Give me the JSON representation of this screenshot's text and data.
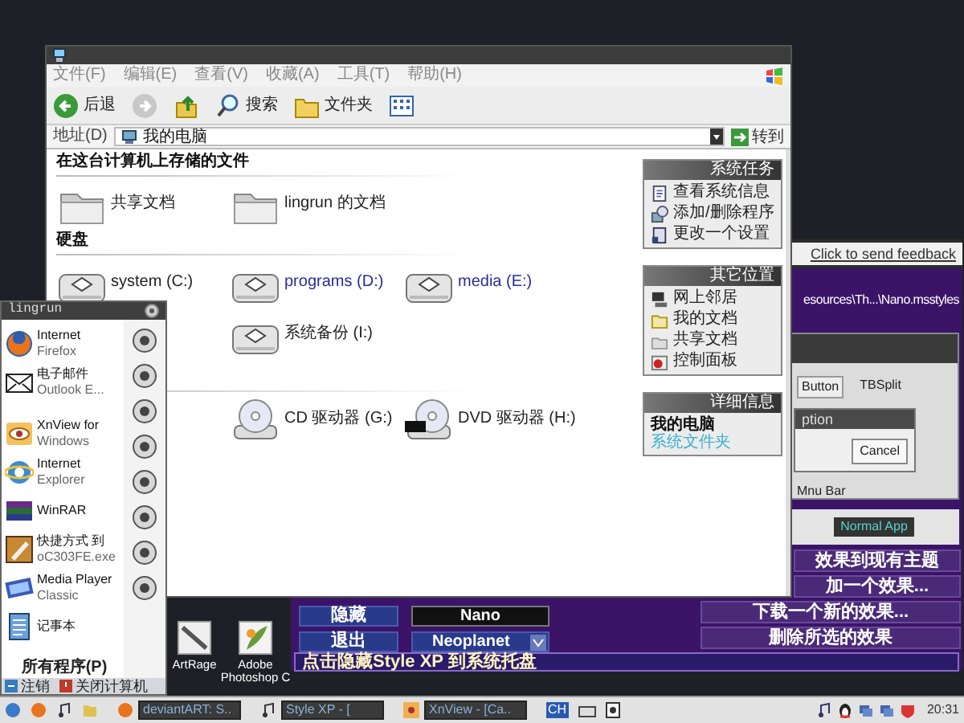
{
  "explorer": {
    "menu": [
      "文件(F)",
      "编辑(E)",
      "查看(V)",
      "收藏(A)",
      "工具(T)",
      "帮助(H)"
    ],
    "toolbar": [
      {
        "kind": "back",
        "label": "后退"
      },
      {
        "kind": "forward"
      },
      {
        "kind": "up"
      },
      {
        "kind": "search",
        "label": "搜索"
      },
      {
        "kind": "folders",
        "label": "文件夹"
      },
      {
        "kind": "views"
      }
    ],
    "address": {
      "label": "地址(D)",
      "value": "我的电脑",
      "go": "转到"
    },
    "sections": [
      {
        "title": "在这台计算机上存储的文件",
        "items": [
          {
            "kind": "folder",
            "label": "共享文档"
          },
          {
            "kind": "folder",
            "label": "lingrun 的文档"
          }
        ]
      },
      {
        "title": "硬盘",
        "items": [
          {
            "kind": "hdd",
            "label": "system (C:)",
            "color": "#222222"
          },
          {
            "kind": "hdd",
            "label": "programs (D:)",
            "color": "#2a2a9a"
          },
          {
            "kind": "hdd",
            "label": "media (E:)",
            "color": "#2a2a9a"
          },
          {
            "kind": "covered"
          },
          {
            "kind": "hdd",
            "label": "系统备份 (I:)",
            "color": "#222222"
          }
        ]
      },
      {
        "items": [
          {
            "kind": "covered"
          },
          {
            "kind": "cd",
            "label": "CD 驱动器 (G:)"
          },
          {
            "kind": "dvd",
            "label": "DVD 驱动器 (H:)"
          }
        ]
      }
    ],
    "panels": [
      {
        "title": "系统任务",
        "items": [
          {
            "kind": "info",
            "label": "查看系统信息"
          },
          {
            "kind": "addremove",
            "label": "添加/删除程序"
          },
          {
            "kind": "settings",
            "label": "更改一个设置"
          }
        ]
      },
      {
        "title": "其它位置",
        "items": [
          {
            "kind": "network",
            "label": "网上邻居"
          },
          {
            "kind": "docs",
            "label": "我的文档"
          },
          {
            "kind": "shared",
            "label": "共享文档"
          },
          {
            "kind": "control",
            "label": "控制面板"
          }
        ]
      }
    ],
    "details": {
      "title": "详细信息",
      "name": "我的电脑",
      "type": "系统文件夹"
    }
  },
  "start_menu": {
    "user": "lingrun",
    "items": [
      {
        "kind": "firefox",
        "lines": [
          "Internet",
          "Firefox"
        ]
      },
      {
        "kind": "mail",
        "lines": [
          "电子邮件",
          "Outlook E..."
        ]
      },
      {
        "kind": "xnview",
        "lines": [
          "XnView for",
          "Windows"
        ]
      },
      {
        "kind": "ie",
        "lines": [
          "Internet",
          "Explorer"
        ]
      },
      {
        "kind": "winrar",
        "lines": [
          "WinRAR"
        ]
      },
      {
        "kind": "paint",
        "lines": [
          "快捷方式 到",
          "oC303FE.exe"
        ]
      },
      {
        "kind": "film",
        "lines": [
          "Media Player",
          "Classic"
        ]
      },
      {
        "kind": "notepad",
        "lines": [
          "记事本"
        ]
      }
    ],
    "all_programs": "所有程序(P)",
    "logoff": "注销",
    "shutdown": "关闭计算机"
  },
  "desktop_icons": [
    {
      "kind": "artrage",
      "lines": [
        "ArtRage"
      ]
    },
    {
      "kind": "photoshop",
      "lines": [
        "Adobe",
        "Photoshop C"
      ]
    }
  ],
  "style_xp": {
    "feedback": "Click to send feedback",
    "path": "esources\\Th...\\Nano.msstyles",
    "preview": {
      "button": "Button",
      "split": "TBSplit",
      "dialog": "ption",
      "cancel": "Cancel",
      "menu_bar": "Mnu Bar",
      "app": "Normal App"
    },
    "actions": [
      "效果到现有主题",
      "加一个效果...",
      "下载一个新的效果...",
      "删除所选的效果"
    ],
    "hide": "隐藏",
    "exit": "退出",
    "theme": "Nano",
    "theme_select": "Neoplanet",
    "footer": "点击隐藏Style XP 到系统托盘"
  },
  "taskbar": {
    "tasks": [
      {
        "kind": "web",
        "label": "deviantART: S.."
      },
      {
        "kind": "music",
        "label": "Style XP - ["
      },
      {
        "kind": "viewer",
        "label": "XnView - [Ca.."
      }
    ],
    "language": "CH",
    "clock": "20:31"
  }
}
